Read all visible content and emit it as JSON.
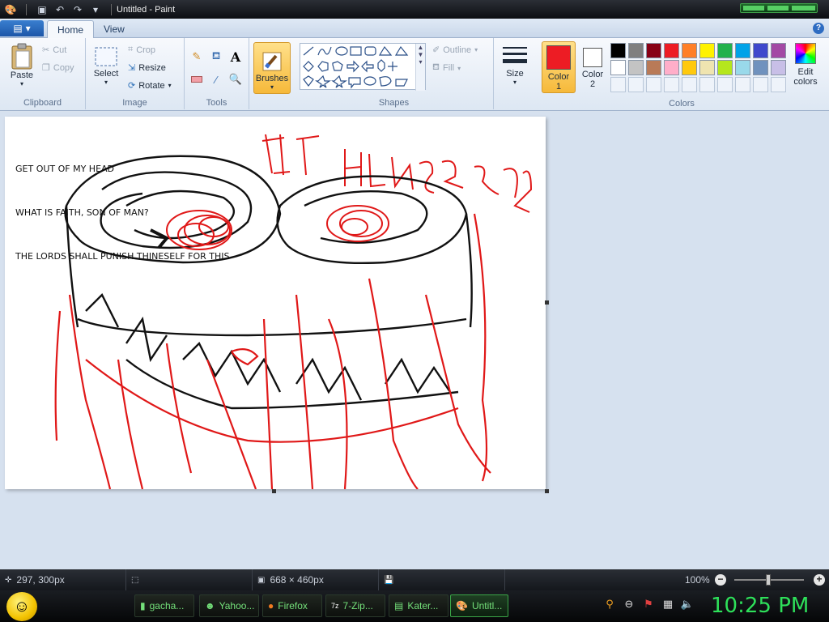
{
  "window": {
    "title": "Untitled - Paint"
  },
  "tabs": [
    {
      "label": "Home"
    },
    {
      "label": "View"
    }
  ],
  "ribbon": {
    "clipboard": {
      "group_label": "Clipboard",
      "paste": "Paste",
      "cut": "Cut",
      "copy": "Copy"
    },
    "image": {
      "group_label": "Image",
      "select": "Select",
      "crop": "Crop",
      "resize": "Resize",
      "rotate": "Rotate"
    },
    "tools": {
      "group_label": "Tools"
    },
    "brushes": {
      "label": "Brushes"
    },
    "shapes": {
      "group_label": "Shapes",
      "outline": "Outline",
      "fill": "Fill"
    },
    "size": {
      "label": "Size"
    },
    "colors": {
      "group_label": "Colors",
      "color1_label": "Color",
      "color1_num": "1",
      "color1_value": "#ed1c24",
      "color2_label": "Color",
      "color2_num": "2",
      "color2_value": "#ffffff",
      "edit_colors_line1": "Edit",
      "edit_colors_line2": "colors",
      "palette_row1": [
        "#000000",
        "#7f7f7f",
        "#880015",
        "#ed1c24",
        "#ff7f27",
        "#fff200",
        "#22b14c",
        "#00a2e8",
        "#3f48cc",
        "#a349a4"
      ],
      "palette_row2": [
        "#ffffff",
        "#c3c3c3",
        "#b97a57",
        "#ffaec9",
        "#ffc90e",
        "#efe4b0",
        "#b5e61d",
        "#99d9ea",
        "#7092be",
        "#c8bfe7"
      ]
    }
  },
  "canvas": {
    "lines": [
      "GET OUT OF MY HEAD",
      "WHAT IS FAITH, SON OF MAN?",
      "THE LORDS SHALL PUNISH THINESELF FOR THIS"
    ],
    "size_text": "668 × 460px"
  },
  "status": {
    "cursor_pos": "297, 300px",
    "image_size": "668 × 460px",
    "zoom": "100%"
  },
  "taskbar": {
    "items": [
      {
        "label": "gacha..."
      },
      {
        "label": "Yahoo..."
      },
      {
        "label": "Firefox"
      },
      {
        "label": "7-Zip..."
      },
      {
        "label": "Kater..."
      },
      {
        "label": "Untitl..."
      }
    ],
    "clock": "10:25 PM"
  }
}
